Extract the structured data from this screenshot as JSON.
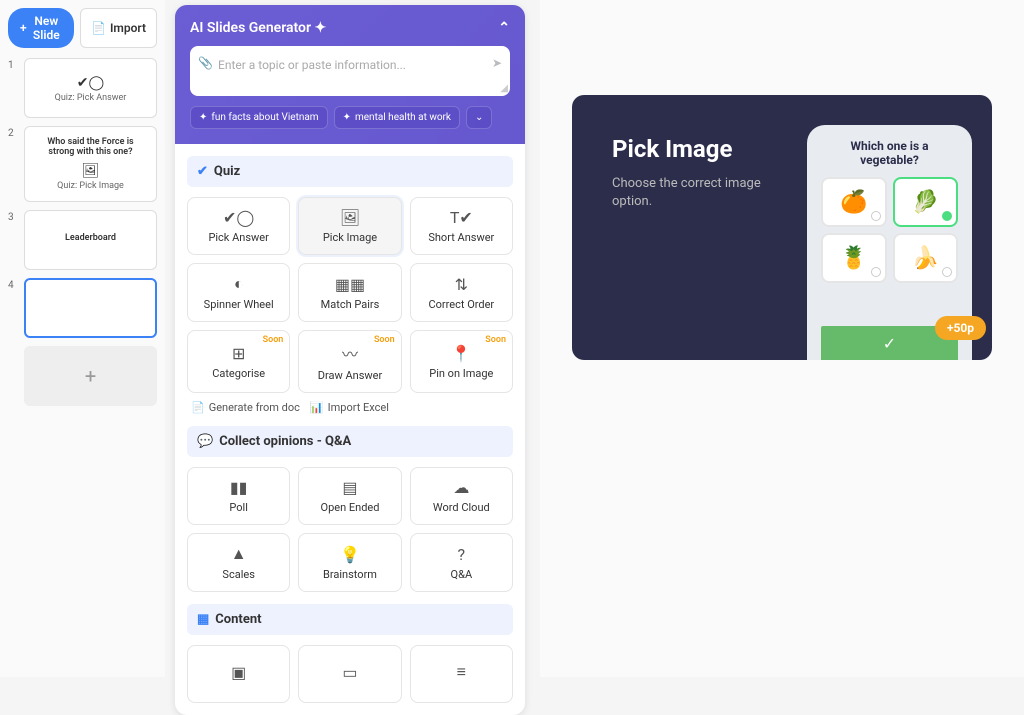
{
  "sidebar": {
    "new_slide_label": "New Slide",
    "import_label": "Import",
    "slides": [
      {
        "num": "1",
        "title": "",
        "sub": "Quiz: Pick Answer",
        "icon": "✔◯"
      },
      {
        "num": "2",
        "title": "Who said the Force is strong with this one?",
        "sub": "Quiz: Pick Image",
        "icon": "🖼"
      },
      {
        "num": "3",
        "title": "Leaderboard",
        "sub": "",
        "icon": ""
      },
      {
        "num": "4",
        "title": "",
        "sub": "",
        "icon": ""
      }
    ]
  },
  "ai": {
    "title": "AI Slides Generator ✦",
    "placeholder": "Enter a topic or paste information...",
    "suggestions": [
      "fun facts about Vietnam",
      "mental health at work"
    ]
  },
  "sections": {
    "quiz": {
      "title": "Quiz",
      "tiles": [
        {
          "label": "Pick Answer",
          "icon": "✔◯"
        },
        {
          "label": "Pick Image",
          "icon": "🖼"
        },
        {
          "label": "Short Answer",
          "icon": "T✔"
        },
        {
          "label": "Spinner Wheel",
          "icon": "◐"
        },
        {
          "label": "Match Pairs",
          "icon": "▦▦"
        },
        {
          "label": "Correct Order",
          "icon": "⇅"
        },
        {
          "label": "Categorise",
          "icon": "⊞",
          "soon": "Soon"
        },
        {
          "label": "Draw Answer",
          "icon": "〰",
          "soon": "Soon"
        },
        {
          "label": "Pin on Image",
          "icon": "📍",
          "soon": "Soon"
        }
      ],
      "gen_doc": "Generate from doc",
      "import_excel": "Import Excel"
    },
    "opinions": {
      "title": "Collect opinions - Q&A",
      "tiles": [
        {
          "label": "Poll",
          "icon": "▮▮"
        },
        {
          "label": "Open Ended",
          "icon": "▤"
        },
        {
          "label": "Word Cloud",
          "icon": "☁"
        },
        {
          "label": "Scales",
          "icon": "▲"
        },
        {
          "label": "Brainstorm",
          "icon": "💡"
        },
        {
          "label": "Q&A",
          "icon": "?"
        }
      ]
    },
    "content": {
      "title": "Content",
      "tiles": [
        {
          "label": "",
          "icon": "▣"
        },
        {
          "label": "",
          "icon": "▭"
        },
        {
          "label": "",
          "icon": "≡"
        }
      ]
    }
  },
  "preview": {
    "title": "Pick Image",
    "desc": "Choose the correct image option.",
    "question": "Which one is a vegetable?",
    "options": [
      "🍊",
      "🥬",
      "🍍",
      "🍌"
    ],
    "points": "+50p"
  }
}
